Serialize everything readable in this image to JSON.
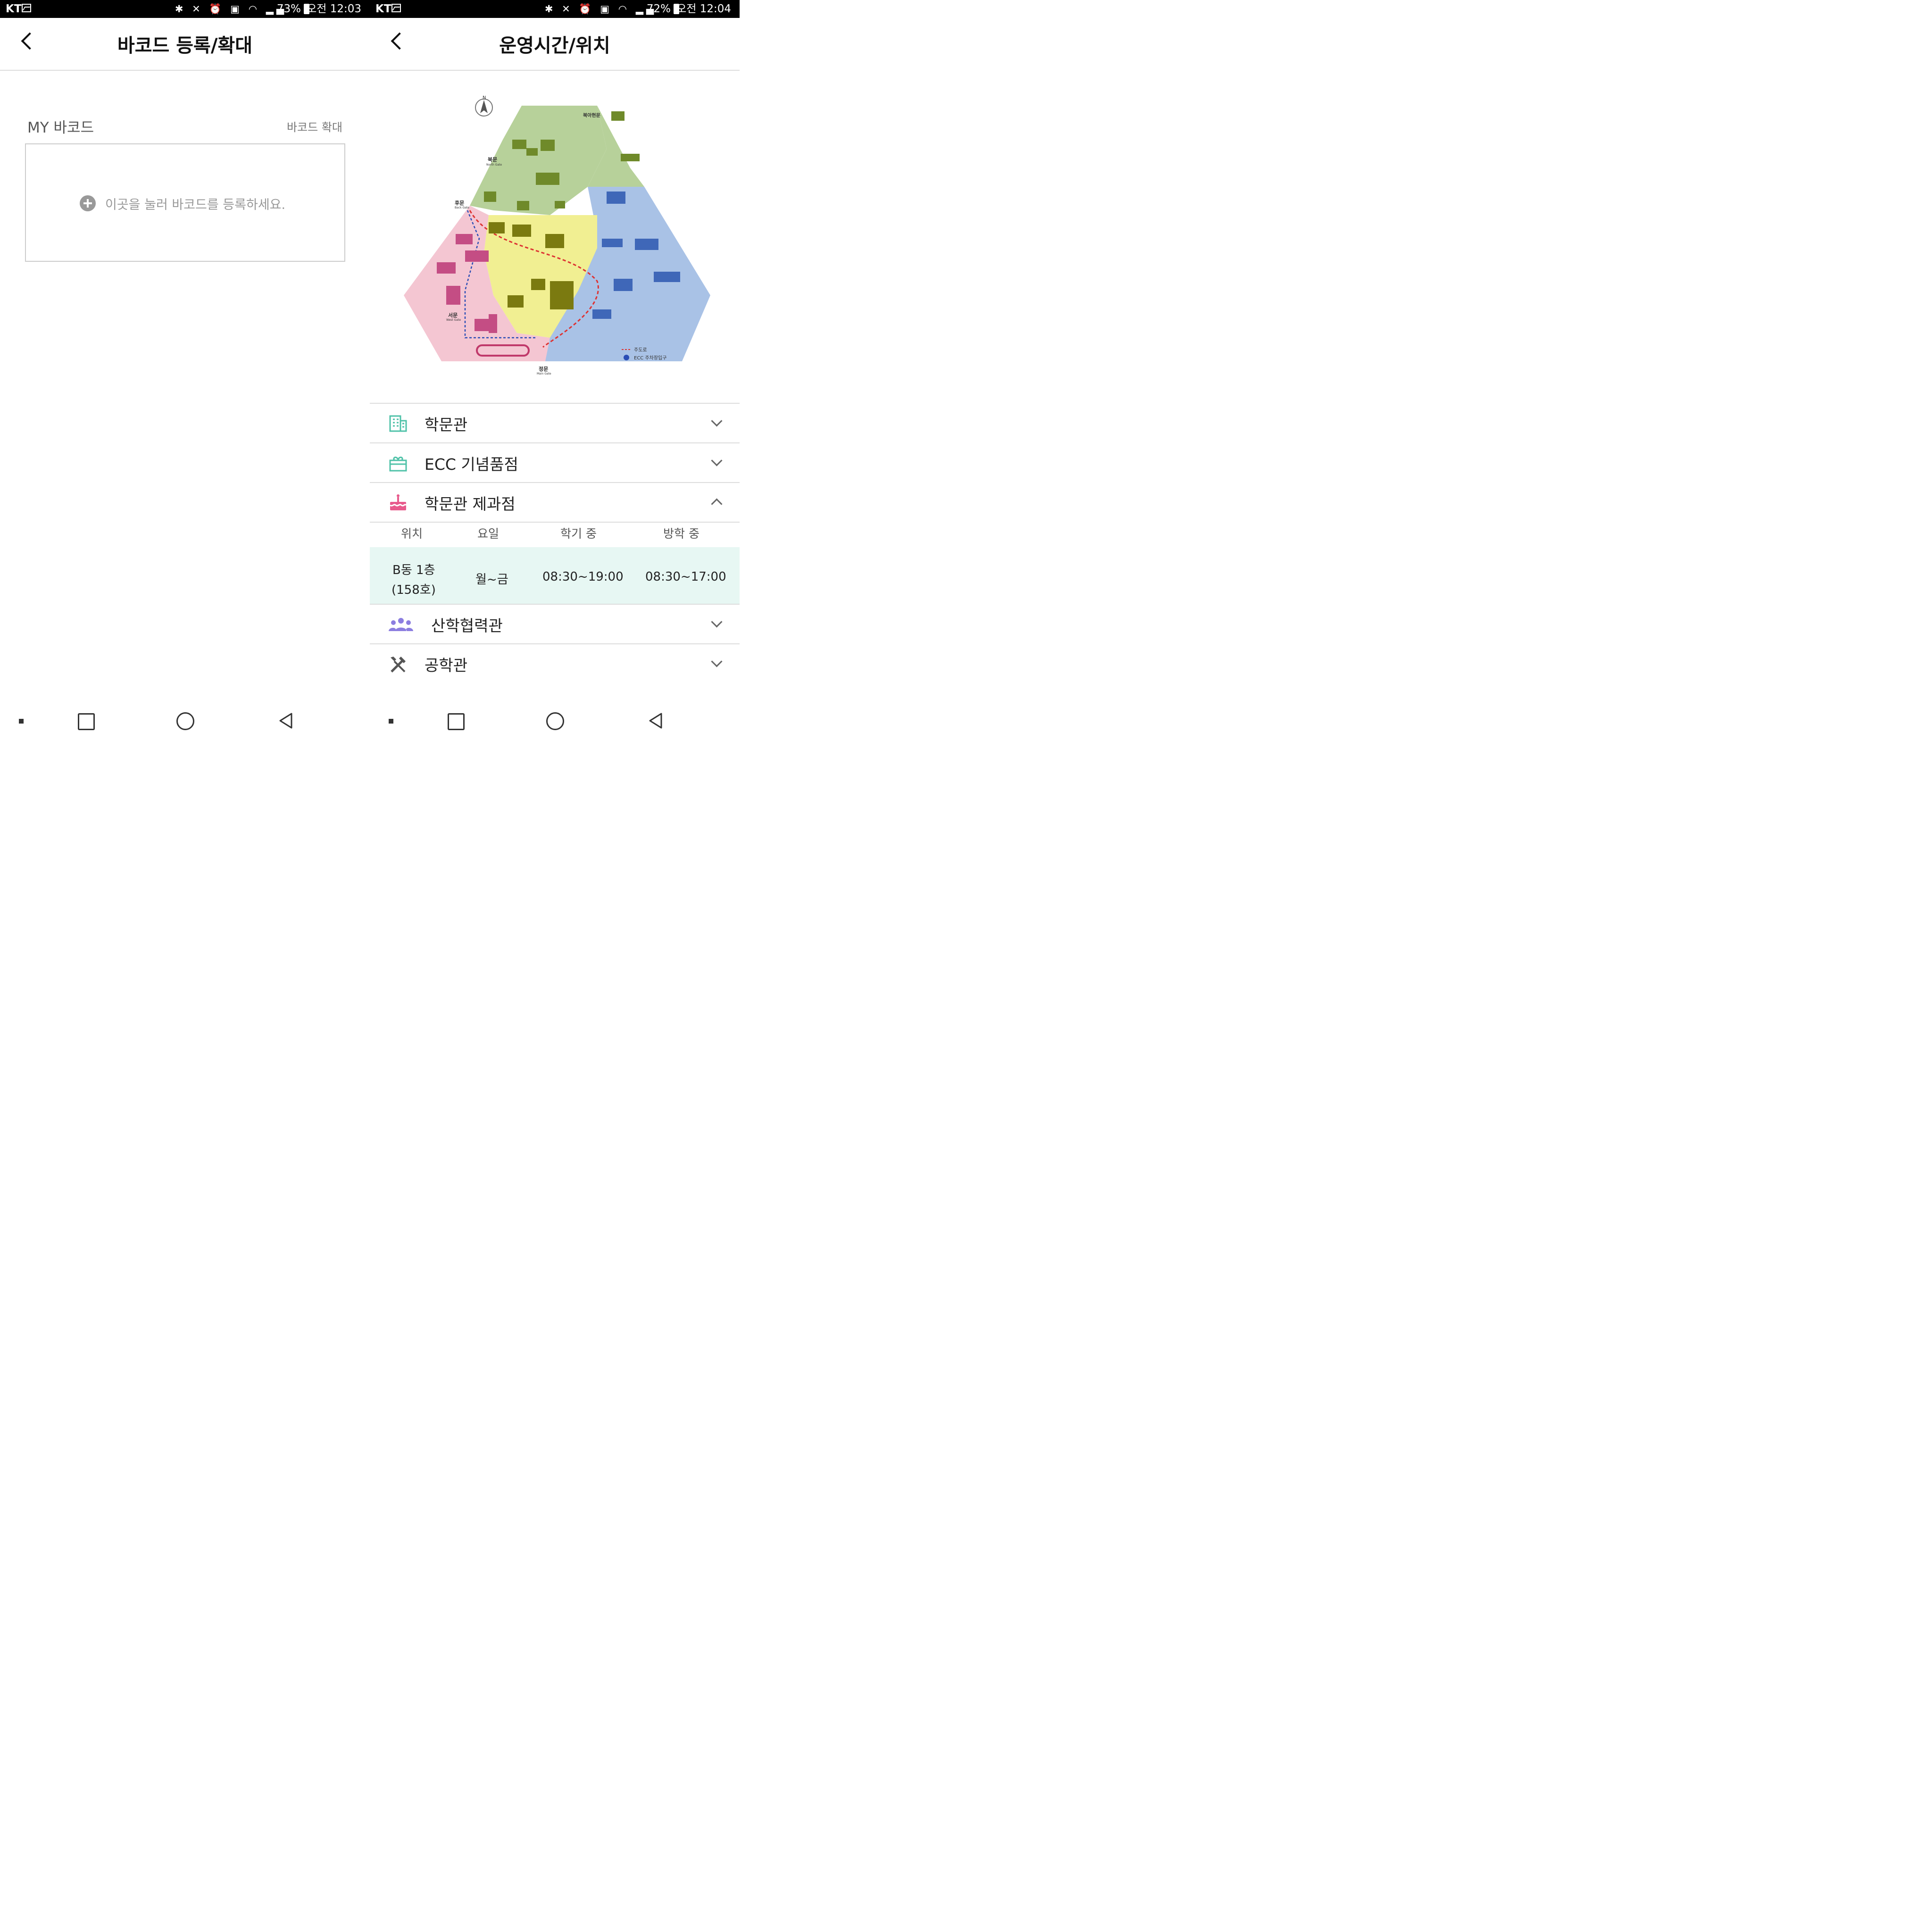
{
  "status_left": {
    "carrier": "KT",
    "battery": "73%",
    "time": "오전 12:03"
  },
  "status_right": {
    "carrier": "KT",
    "battery": "72%",
    "time": "오전 12:04"
  },
  "left": {
    "title": "바코드 등록/확대",
    "section_label": "MY 바코드",
    "expand_link": "바코드 확대",
    "hint": "이곳을 눌러 바코드를 등록하세요."
  },
  "right": {
    "title": "운영시간/위치",
    "map": {
      "compass": "N",
      "gates": {
        "north": "북문",
        "north_sub": "North Gate",
        "back": "후문",
        "back_sub": "Back Gate",
        "west": "서문",
        "west_sub": "West Gate",
        "main": "정문",
        "main_sub": "Main Gate",
        "north_ahyun": "북아현문"
      },
      "legend": {
        "road": "주도로",
        "parking": "ECC 주차장입구"
      }
    },
    "items": [
      {
        "label": "학문관",
        "icon": "building-icon"
      },
      {
        "label": "ECC 기념품점",
        "icon": "gift-icon"
      },
      {
        "label": "학문관 제과점",
        "icon": "cake-icon"
      },
      {
        "label": "산학협력관",
        "icon": "people-icon"
      },
      {
        "label": "공학관",
        "icon": "tools-icon"
      }
    ],
    "table": {
      "headers": [
        "위치",
        "요일",
        "학기 중",
        "방학 중"
      ],
      "row": {
        "location_line1": "B동 1층",
        "location_line2": "(158호)",
        "days": "월~금",
        "semester": "08:30~19:00",
        "vacation": "08:30~17:00"
      }
    }
  },
  "colors": {
    "teal": "#4fc2a8",
    "pink": "#e85a8c",
    "purple": "#8c7ee0",
    "map_green": "#b7d19a",
    "map_yellow": "#f1ef92",
    "map_pink": "#f4c6d2",
    "map_blue": "#a9c2e6"
  }
}
